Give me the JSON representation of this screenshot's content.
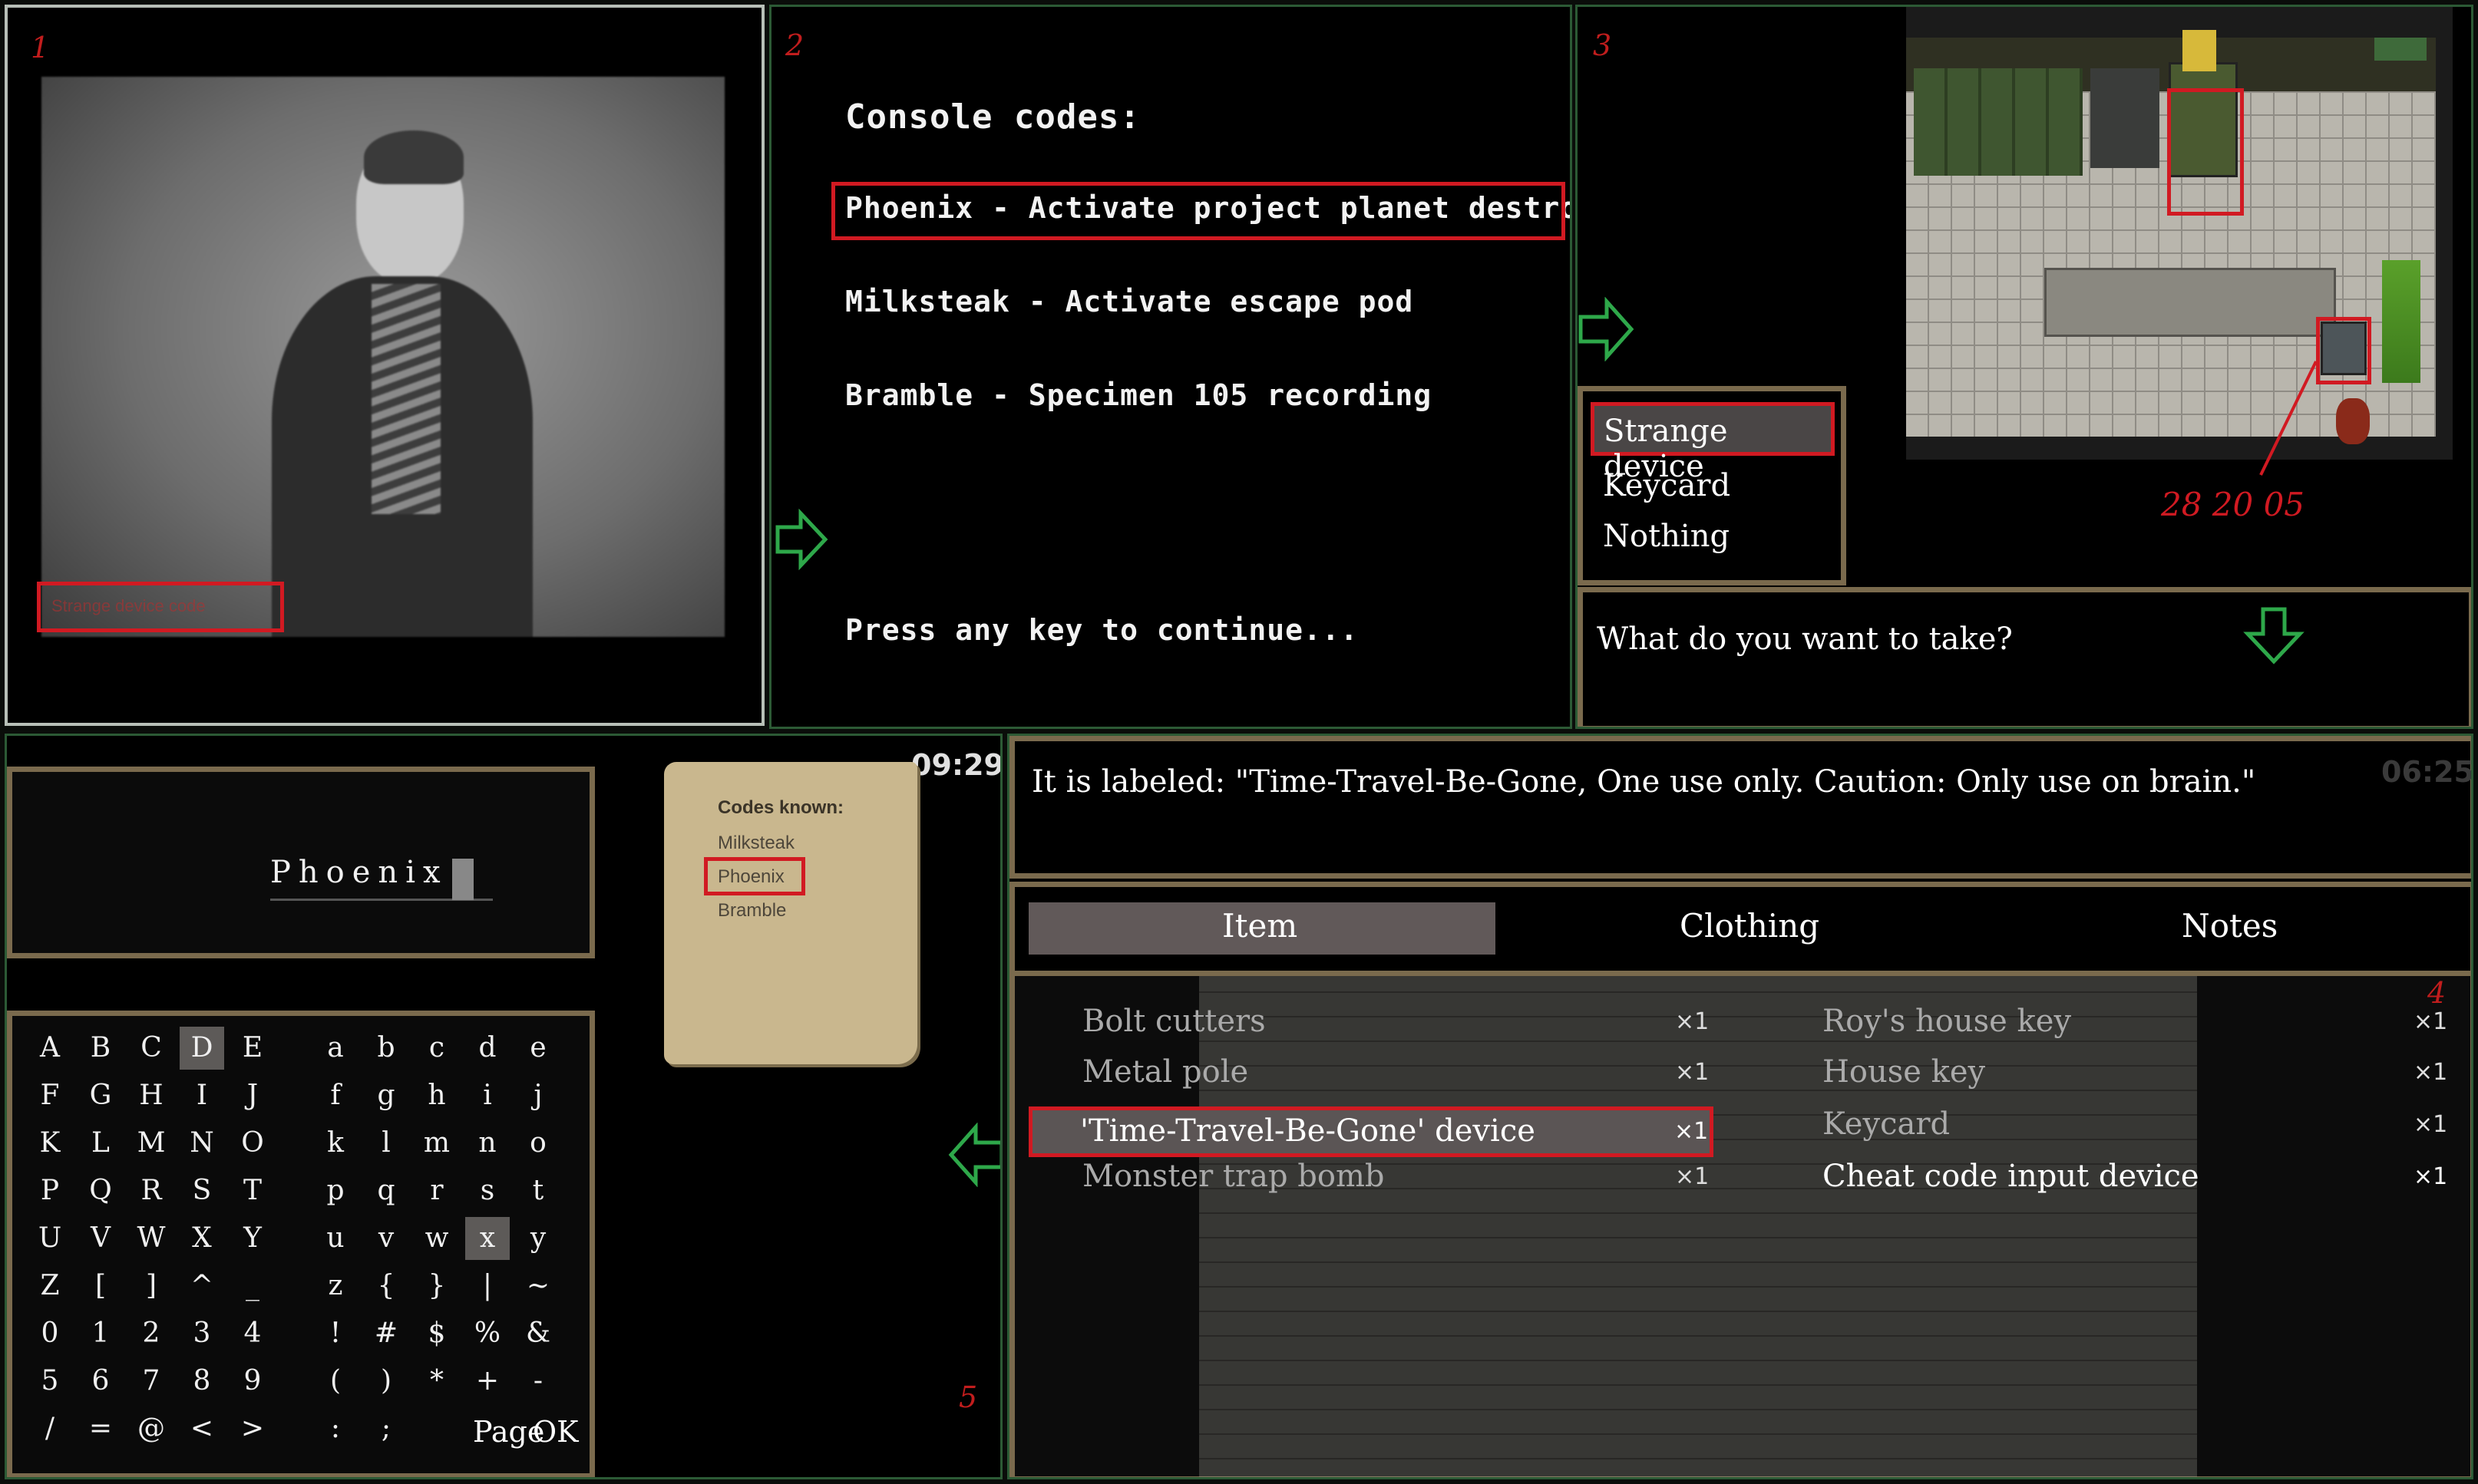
{
  "colors": {
    "accent_red": "#d11a22",
    "arrow_green": "#2ea84a",
    "frame_gold": "#7a6a4d",
    "paper": "#c9b78e"
  },
  "panels": {
    "p1": {
      "num": "1",
      "caption": "Strange device code",
      "icon": "video-frame-icon"
    },
    "p2": {
      "num": "2",
      "title": "Console codes:",
      "codes": [
        "Phoenix - Activate project planet destroyer",
        "Milksteak - Activate escape pod",
        "Bramble - Specimen 105 recording"
      ],
      "prompt": "Press any key to continue..."
    },
    "p3": {
      "num": "3",
      "menu": [
        "Strange device",
        "Keycard",
        "Nothing"
      ],
      "question": "What do you want to take?",
      "annotation": "28 20 05"
    },
    "p4": {
      "num": "4",
      "timer": "06:25",
      "description": "It is labeled: \"Time-Travel-Be-Gone, One use only. Caution: Only use on brain.\"",
      "tabs": [
        "Item",
        "Clothing",
        "Notes"
      ],
      "left_items": [
        {
          "name": "Bolt cutters",
          "qty": "×1"
        },
        {
          "name": "Metal pole",
          "qty": "×1"
        },
        {
          "name": "'Time-Travel-Be-Gone' device",
          "qty": "×1"
        },
        {
          "name": "Monster trap bomb",
          "qty": "×1"
        }
      ],
      "right_items": [
        {
          "name": "Roy's house key",
          "qty": "×1"
        },
        {
          "name": "House key",
          "qty": "×1"
        },
        {
          "name": "Keycard",
          "qty": "×1"
        },
        {
          "name": "Cheat code input device",
          "qty": "×1"
        }
      ]
    },
    "p5": {
      "num": "5",
      "timer": "09:29",
      "input_value": "Phoenix",
      "note_title": "Codes known:",
      "note_codes": [
        "Milksteak",
        "Phoenix",
        "Bramble"
      ],
      "keys": [
        [
          "A",
          "B",
          "C",
          "D",
          "E",
          "a",
          "b",
          "c",
          "d",
          "e"
        ],
        [
          "F",
          "G",
          "H",
          "I",
          "J",
          "f",
          "g",
          "h",
          "i",
          "j"
        ],
        [
          "K",
          "L",
          "M",
          "N",
          "O",
          "k",
          "l",
          "m",
          "n",
          "o"
        ],
        [
          "P",
          "Q",
          "R",
          "S",
          "T",
          "p",
          "q",
          "r",
          "s",
          "t"
        ],
        [
          "U",
          "V",
          "W",
          "X",
          "Y",
          "u",
          "v",
          "w",
          "x",
          "y"
        ],
        [
          "Z",
          "[",
          "]",
          "^",
          "_",
          "z",
          "{",
          "}",
          "|",
          "~"
        ],
        [
          "0",
          "1",
          "2",
          "3",
          "4",
          "!",
          "#",
          "$",
          "%",
          "&"
        ],
        [
          "5",
          "6",
          "7",
          "8",
          "9",
          "(",
          ")",
          "*",
          "+",
          "-"
        ],
        [
          "/",
          "=",
          "@",
          "<",
          ">",
          ":",
          ";",
          "",
          "",
          " "
        ]
      ],
      "page_label": "Page",
      "ok_label": "OK"
    }
  }
}
